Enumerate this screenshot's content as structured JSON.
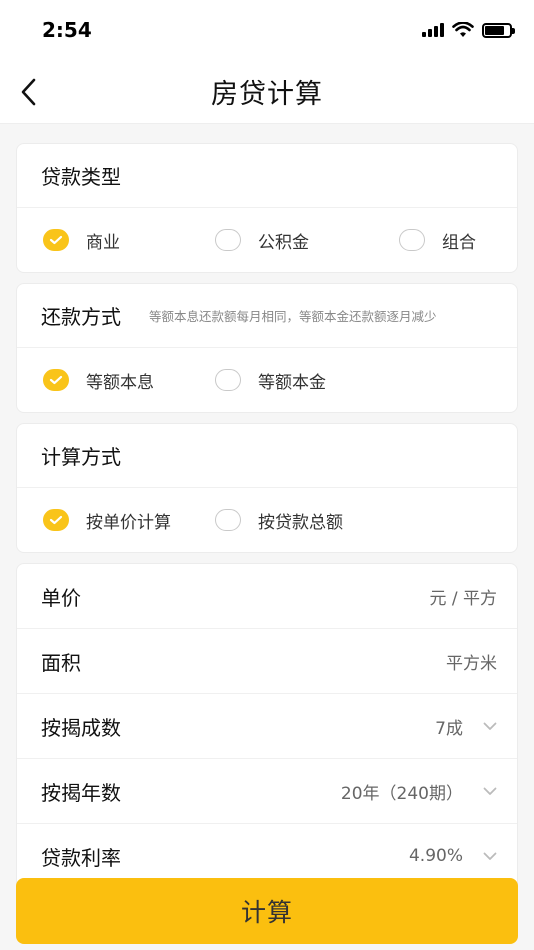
{
  "status_bar": {
    "time": "2:54"
  },
  "header": {
    "title": "房贷计算"
  },
  "loan_type": {
    "title": "贷款类型",
    "options": [
      {
        "label": "商业",
        "checked": true
      },
      {
        "label": "公积金",
        "checked": false
      },
      {
        "label": "组合",
        "checked": false
      }
    ]
  },
  "repayment": {
    "title": "还款方式",
    "hint": "等额本息还款额每月相同，等额本金还款额逐月减少",
    "options": [
      {
        "label": "等额本息",
        "checked": true
      },
      {
        "label": "等额本金",
        "checked": false
      }
    ]
  },
  "calc_method": {
    "title": "计算方式",
    "options": [
      {
        "label": "按单价计算",
        "checked": true
      },
      {
        "label": "按贷款总额",
        "checked": false
      }
    ]
  },
  "form": {
    "unit_price": {
      "label": "单价",
      "value": "元 / 平方"
    },
    "area": {
      "label": "面积",
      "value": "平方米"
    },
    "down_payment_ratio": {
      "label": "按揭成数",
      "value": "7成"
    },
    "loan_years": {
      "label": "按揭年数",
      "value": "20年（240期）"
    },
    "interest_rate": {
      "label": "贷款利率",
      "value": "4.90%"
    }
  },
  "calculate_button": {
    "label": "计算"
  },
  "colors": {
    "accent": "#fbbf0f",
    "radio_checked": "#f9c41a"
  },
  "icons": [
    "back-arrow-icon",
    "check-icon",
    "chevron-down-icon",
    "signal-icon",
    "wifi-icon",
    "battery-icon"
  ]
}
